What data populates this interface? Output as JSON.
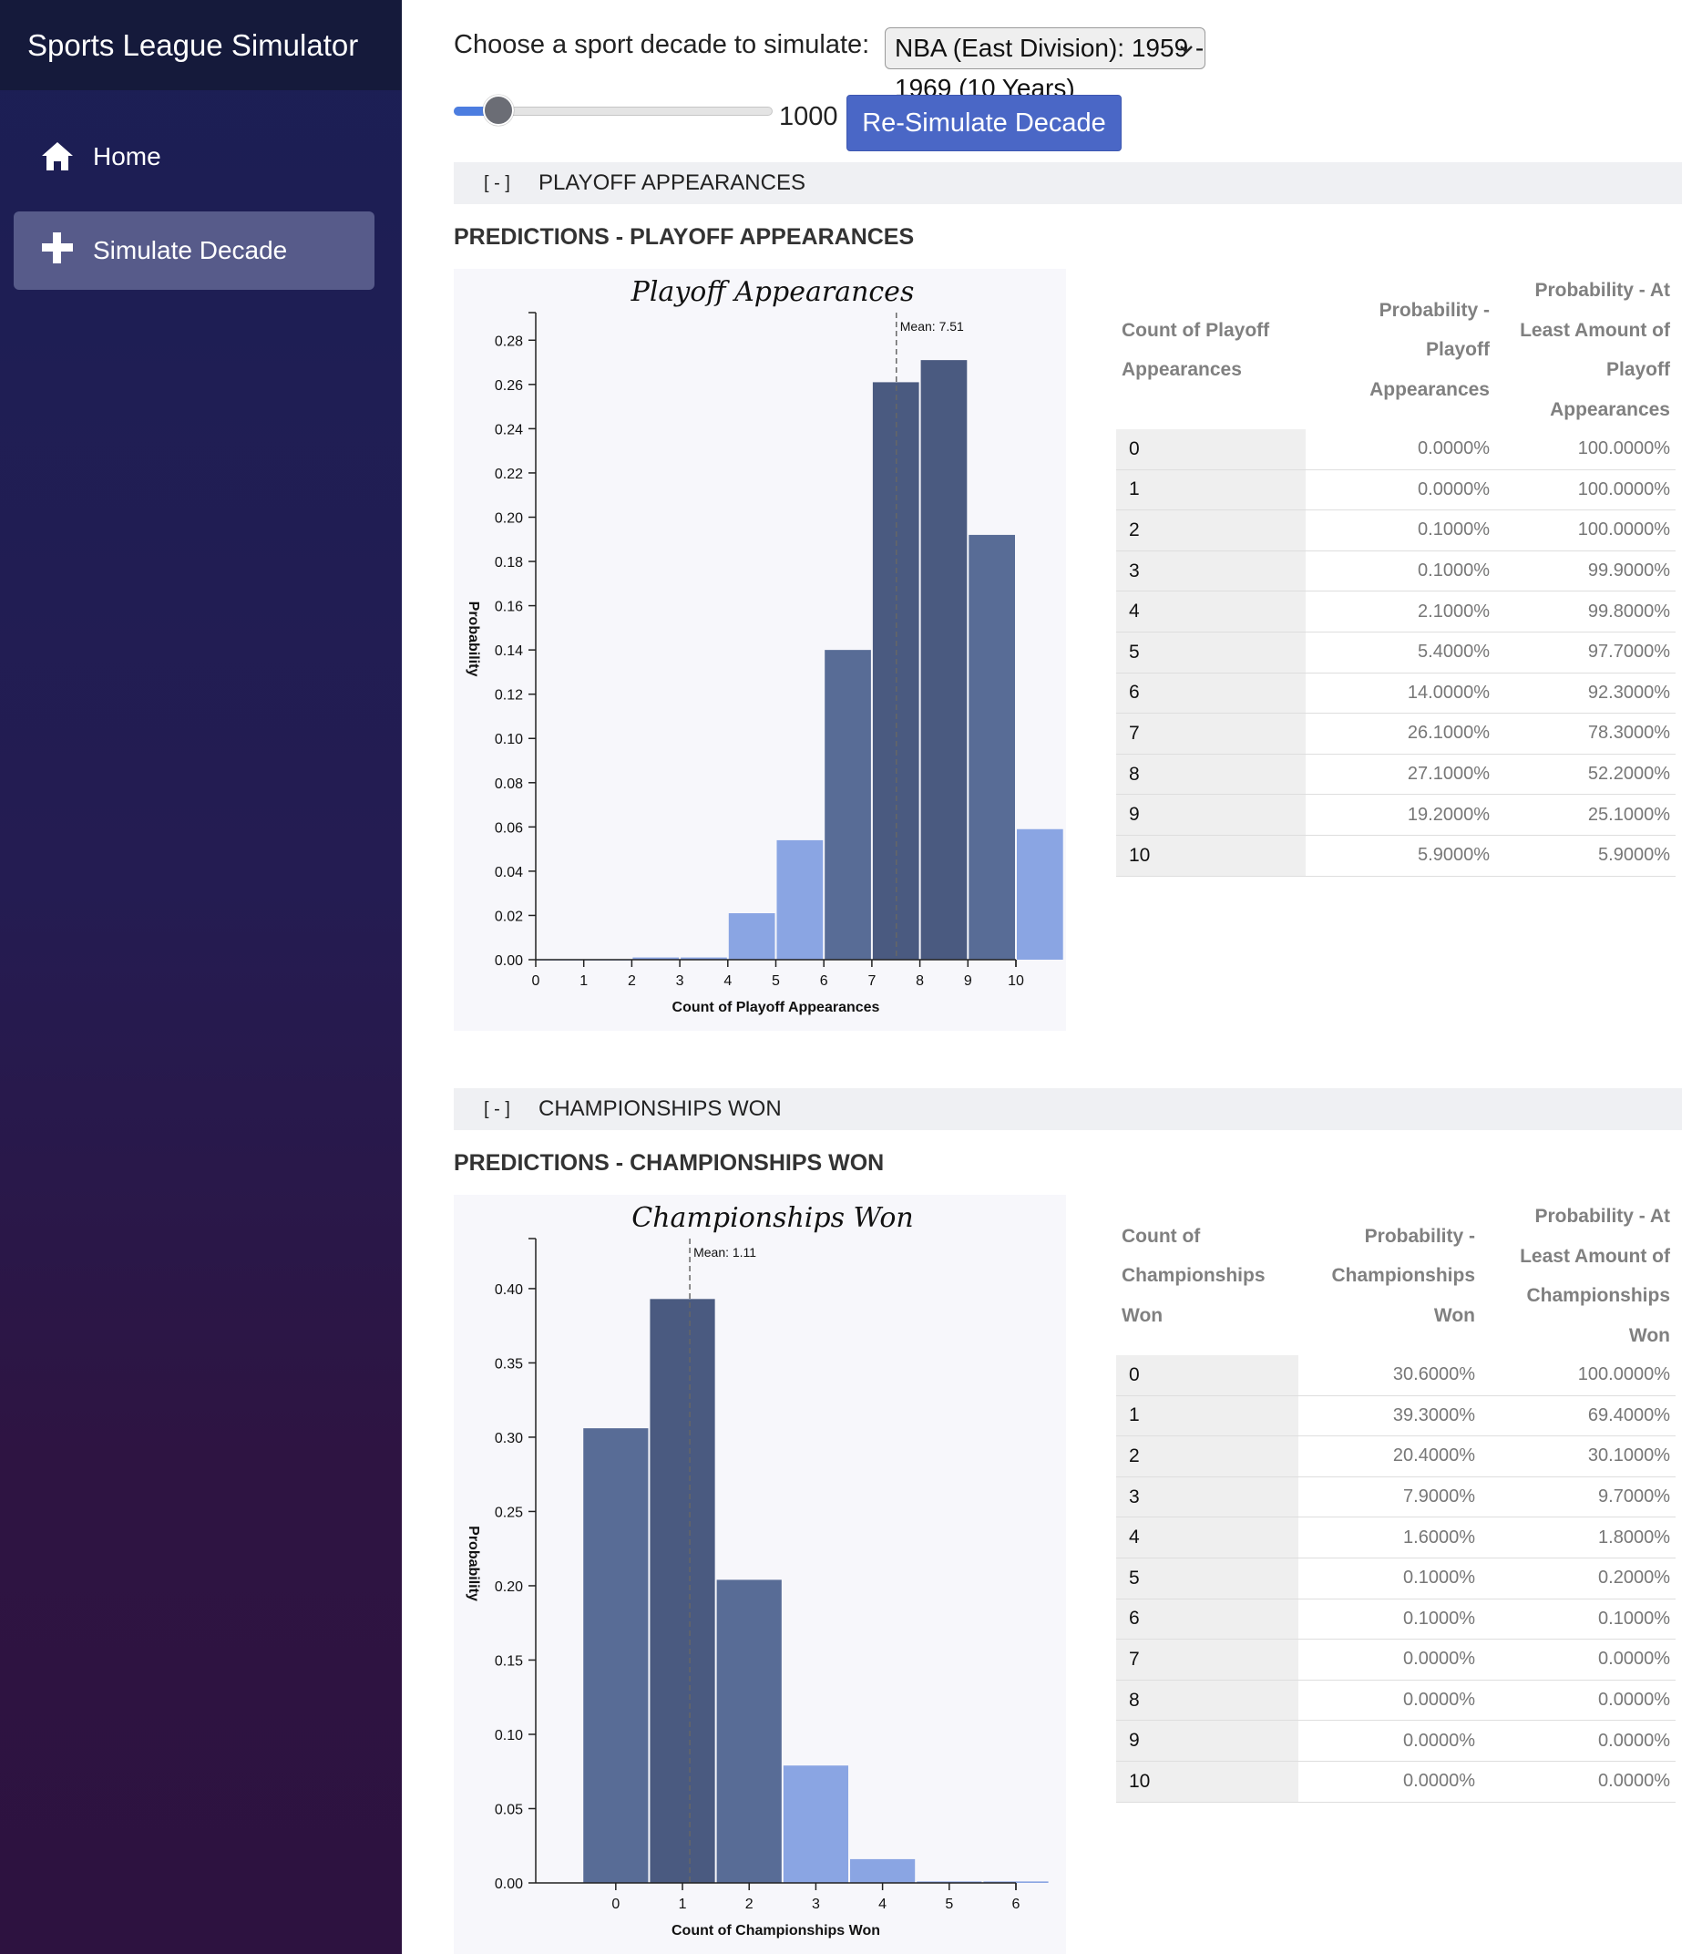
{
  "sidebar": {
    "brand": "Sports League Simulator",
    "items": [
      {
        "label": "Home",
        "icon": "home-icon",
        "active": false
      },
      {
        "label": "Simulate Decade",
        "icon": "plus-icon",
        "active": true
      }
    ]
  },
  "controls": {
    "chooser_label": "Choose a sport decade to simulate:",
    "decade_selected": "NBA (East Division): 1959 - 1969 (10 Years)",
    "simulation_count": "1000",
    "slider_fraction": 0.1,
    "resimulate_label": "Re-Simulate Decade"
  },
  "colors": {
    "accent": "#4a67c6",
    "sidebar_top": "#1b1f55",
    "sidebar_bottom": "#2d1240",
    "bar_light": "#8aa5e3",
    "bar_mid": "#6b89c2",
    "bar_dark": "#4a5a80"
  },
  "sections": [
    {
      "toggle": "[ - ]",
      "bar_title": "PLAYOFF APPEARANCES",
      "heading": "PREDICTIONS - PLAYOFF APPEARANCES",
      "table": {
        "headers": [
          "Count of Playoff Appearances",
          "Probability - Playoff Appearances",
          "Probability - At Least Amount of Playoff Appearances"
        ],
        "rows": [
          [
            "0",
            "0.0000%",
            "100.0000%"
          ],
          [
            "1",
            "0.0000%",
            "100.0000%"
          ],
          [
            "2",
            "0.1000%",
            "100.0000%"
          ],
          [
            "3",
            "0.1000%",
            "99.9000%"
          ],
          [
            "4",
            "2.1000%",
            "99.8000%"
          ],
          [
            "5",
            "5.4000%",
            "97.7000%"
          ],
          [
            "6",
            "14.0000%",
            "92.3000%"
          ],
          [
            "7",
            "26.1000%",
            "78.3000%"
          ],
          [
            "8",
            "27.1000%",
            "52.2000%"
          ],
          [
            "9",
            "19.2000%",
            "25.1000%"
          ],
          [
            "10",
            "5.9000%",
            "5.9000%"
          ]
        ]
      }
    },
    {
      "toggle": "[ - ]",
      "bar_title": "CHAMPIONSHIPS WON",
      "heading": "PREDICTIONS - CHAMPIONSHIPS WON",
      "table": {
        "headers": [
          "Count of Championships Won",
          "Probability - Championships Won",
          "Probability - At Least Amount of Championships Won"
        ],
        "rows": [
          [
            "0",
            "30.6000%",
            "100.0000%"
          ],
          [
            "1",
            "39.3000%",
            "69.4000%"
          ],
          [
            "2",
            "20.4000%",
            "30.1000%"
          ],
          [
            "3",
            "7.9000%",
            "9.7000%"
          ],
          [
            "4",
            "1.6000%",
            "1.8000%"
          ],
          [
            "5",
            "0.1000%",
            "0.2000%"
          ],
          [
            "6",
            "0.1000%",
            "0.1000%"
          ],
          [
            "7",
            "0.0000%",
            "0.0000%"
          ],
          [
            "8",
            "0.0000%",
            "0.0000%"
          ],
          [
            "9",
            "0.0000%",
            "0.0000%"
          ],
          [
            "10",
            "0.0000%",
            "0.0000%"
          ]
        ]
      }
    }
  ],
  "chart_data": [
    {
      "type": "bar",
      "title": "Playoff Appearances",
      "xlabel": "Count of Playoff Appearances",
      "ylabel": "Probability",
      "x": [
        0,
        1,
        2,
        3,
        4,
        5,
        6,
        7,
        8,
        9,
        10
      ],
      "values": [
        0.0,
        0.0,
        0.001,
        0.001,
        0.021,
        0.054,
        0.14,
        0.261,
        0.271,
        0.192,
        0.059
      ],
      "xlim": [
        0,
        10
      ],
      "xticks": [
        0,
        1,
        2,
        3,
        4,
        5,
        6,
        7,
        8,
        9,
        10
      ],
      "ylim": [
        0,
        0.29
      ],
      "yticks": [
        "0.00",
        "0.02",
        "0.04",
        "0.06",
        "0.08",
        "0.10",
        "0.12",
        "0.14",
        "0.16",
        "0.18",
        "0.20",
        "0.22",
        "0.24",
        "0.26",
        "0.28"
      ],
      "mean": 7.51,
      "mean_label": "Mean: 7.51"
    },
    {
      "type": "bar",
      "title": "Championships Won",
      "xlabel": "Count of Championships Won",
      "ylabel": "Probability",
      "x": [
        0,
        1,
        2,
        3,
        4,
        5,
        6
      ],
      "values": [
        0.306,
        0.393,
        0.204,
        0.079,
        0.016,
        0.001,
        0.001
      ],
      "xlim": [
        -1.2,
        6
      ],
      "xticks": [
        0,
        1,
        2,
        3,
        4,
        5,
        6
      ],
      "ylim": [
        0,
        0.43
      ],
      "yticks": [
        "0.00",
        "0.05",
        "0.10",
        "0.15",
        "0.20",
        "0.25",
        "0.30",
        "0.35",
        "0.40"
      ],
      "mean": 1.11,
      "mean_label": "Mean: 1.11"
    }
  ]
}
